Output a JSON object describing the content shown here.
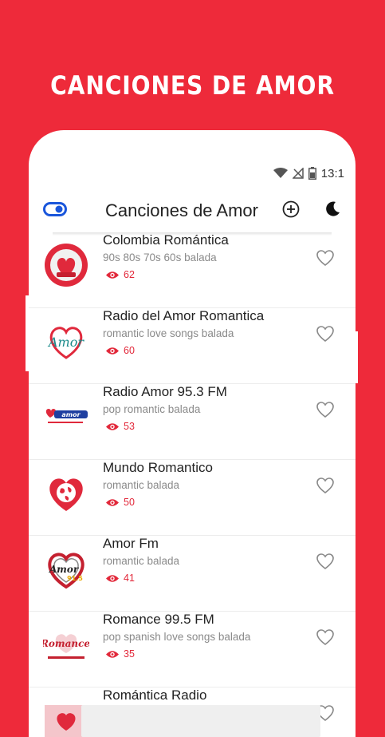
{
  "promo": {
    "title": "CANCIONES DE AMOR"
  },
  "status": {
    "time": "13:1"
  },
  "appbar": {
    "title": "Canciones de Amor"
  },
  "colors": {
    "brand_red": "#ee2a3a",
    "accent_blue": "#1a56db",
    "views_red": "#e2283a"
  },
  "stations": [
    {
      "name": "Colombia Romántica",
      "tags": "90s 80s 70s 60s balada",
      "views": "62",
      "logo": "colombia-romantica-logo"
    },
    {
      "name": "Radio del Amor Romantica",
      "tags": "romantic love songs balada",
      "views": "60",
      "logo": "radio-del-amor-logo"
    },
    {
      "name": "Radio Amor 95.3 FM",
      "tags": "pop romantic balada",
      "views": "53",
      "logo": "radio-amor-953-logo"
    },
    {
      "name": "Mundo Romantico",
      "tags": "romantic balada",
      "views": "50",
      "logo": "mundo-romantico-logo"
    },
    {
      "name": "Amor Fm",
      "tags": "romantic balada",
      "views": "41",
      "logo": "amor-fm-logo"
    },
    {
      "name": "Romance 99.5 FM",
      "tags": "pop spanish love songs balada",
      "views": "35",
      "logo": "romance-995-logo"
    },
    {
      "name": "Romántica Radio",
      "tags": "",
      "views": "",
      "logo": "romantica-radio-logo"
    }
  ]
}
